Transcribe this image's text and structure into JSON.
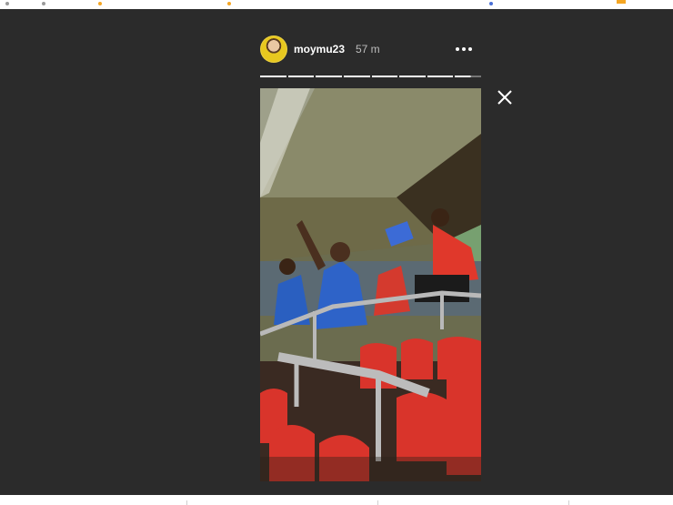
{
  "story": {
    "username": "moymu23",
    "timestamp": "57 m",
    "segments": [
      1,
      1,
      1,
      1,
      1,
      1,
      1,
      0.6
    ]
  },
  "icons": {
    "avatar": "profile-avatar",
    "more": "more-options-icon",
    "close": "close-icon"
  },
  "colors": {
    "background": "#2b2b2b",
    "text": "#ffffff",
    "muted": "#bdbdbd",
    "seat_red": "#d9342b"
  }
}
